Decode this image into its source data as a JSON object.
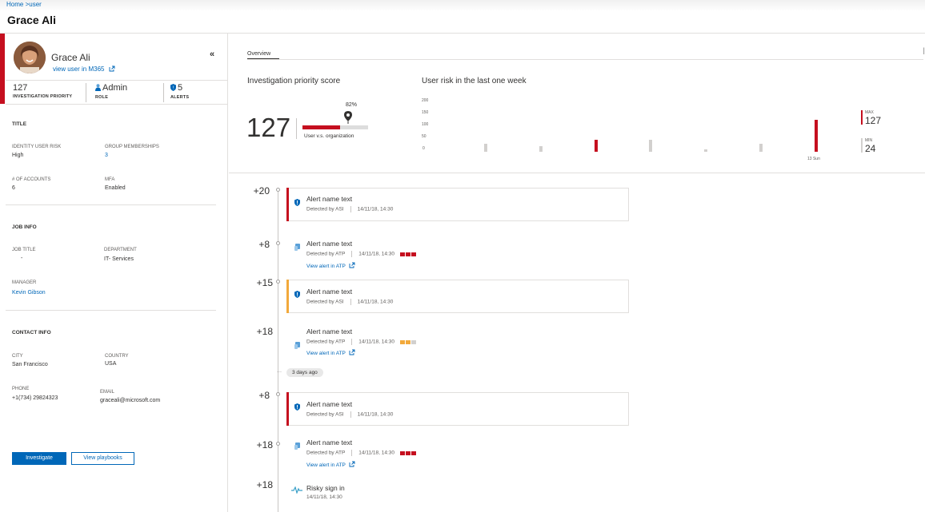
{
  "breadcrumb": {
    "home": "Home",
    "sep": " >",
    "current": "user"
  },
  "page_title": "Grace Ali",
  "profile": {
    "name": "Grace Ali",
    "m365_link": "view user in M365",
    "stats": [
      {
        "value": "127",
        "label": "INVESTIGATION PRIORITY"
      },
      {
        "value": "Admin",
        "label": "ROLE"
      },
      {
        "value": "5",
        "label": "ALERTS"
      }
    ]
  },
  "sections": {
    "title": "TITLE",
    "job_info": "JOB INFO",
    "contact_info": "CONTACT INFO"
  },
  "fields": {
    "identity_user_risk": {
      "label": "IDENTITY USER RISK",
      "value": "High"
    },
    "group_memberships": {
      "label": "GROUP MEMBERSHIPS",
      "value": "3"
    },
    "accounts": {
      "label": "# OF ACCOUNTS",
      "value": "6"
    },
    "mfa": {
      "label": "MFA",
      "value": "Enabled"
    },
    "job_title": {
      "label": "JOB TITLE",
      "value": "-"
    },
    "department": {
      "label": "DEPARTMENT",
      "value": "IT- Services"
    },
    "manager": {
      "label": "MANAGER",
      "value": "Kevin Gibson"
    },
    "city": {
      "label": "CITY",
      "value": "San Francisco"
    },
    "country": {
      "label": "COUNTRY",
      "value": "USA"
    },
    "phone": {
      "label": "PHONE",
      "value": "+1(734) 29824323"
    },
    "email": {
      "label": "EMAIL",
      "value": "graceali@microsoft.com"
    }
  },
  "actions": {
    "investigate": "Investigate",
    "view_playbooks": "View playbooks"
  },
  "tabs": {
    "overview": "Overview",
    "end_marker": "│"
  },
  "priority": {
    "heading": "Investigation priority score",
    "score": "127",
    "percent_label": "82%",
    "percent": 0.82,
    "caption": "User v.s. organization"
  },
  "chart_data": {
    "type": "bar",
    "title": "User risk in the last one week",
    "y_ticks": [
      "200",
      "150",
      "100",
      "50",
      "0"
    ],
    "ylim": [
      0,
      200
    ],
    "x_label": "13 Sun",
    "values": [
      30,
      22,
      48,
      48,
      10,
      30,
      125
    ],
    "highlighted": [
      false,
      false,
      true,
      false,
      false,
      false,
      true
    ],
    "colors": {
      "high": "#c50f1f",
      "normal": "#d2d0ce"
    },
    "legend": {
      "max_label": "MAX",
      "max_value": "127",
      "min_label": "MIN",
      "min_value": "24"
    }
  },
  "timeline": {
    "days_ago": "3 days ago",
    "events": [
      {
        "score": "+20",
        "title": "Alert name text",
        "source": "Detected by ASI",
        "time": "14/11/18, 14:30",
        "link": ""
      },
      {
        "score": "+8",
        "title": "Alert name text",
        "source": "Detected by ATP",
        "time": "14/11/18, 14:30",
        "link": "View alert in ATP"
      },
      {
        "score": "+15",
        "title": "Alert name text",
        "source": "Detected by ASI",
        "time": "14/11/18, 14:30",
        "link": ""
      },
      {
        "score": "+18",
        "title": "Alert name text",
        "source": "Detected by ATP",
        "time": "14/11/18, 14:30",
        "link": "View alert in ATP"
      },
      {
        "score": "+8",
        "title": "Alert name text",
        "source": "Detected by ASI",
        "time": "14/11/18, 14:30",
        "link": ""
      },
      {
        "score": "+18",
        "title": "Alert name text",
        "source": "Detected by ATP",
        "time": "14/11/18, 14:30",
        "link": "View alert in ATP"
      },
      {
        "score": "+18",
        "title": "Risky sign in",
        "source": "",
        "time": "14/11/18, 14:30",
        "link": ""
      }
    ],
    "colors": {
      "red": "#c50f1f",
      "amber": "#f2a93b",
      "grey": "#d2d0ce",
      "blue": "#0067b8"
    }
  }
}
